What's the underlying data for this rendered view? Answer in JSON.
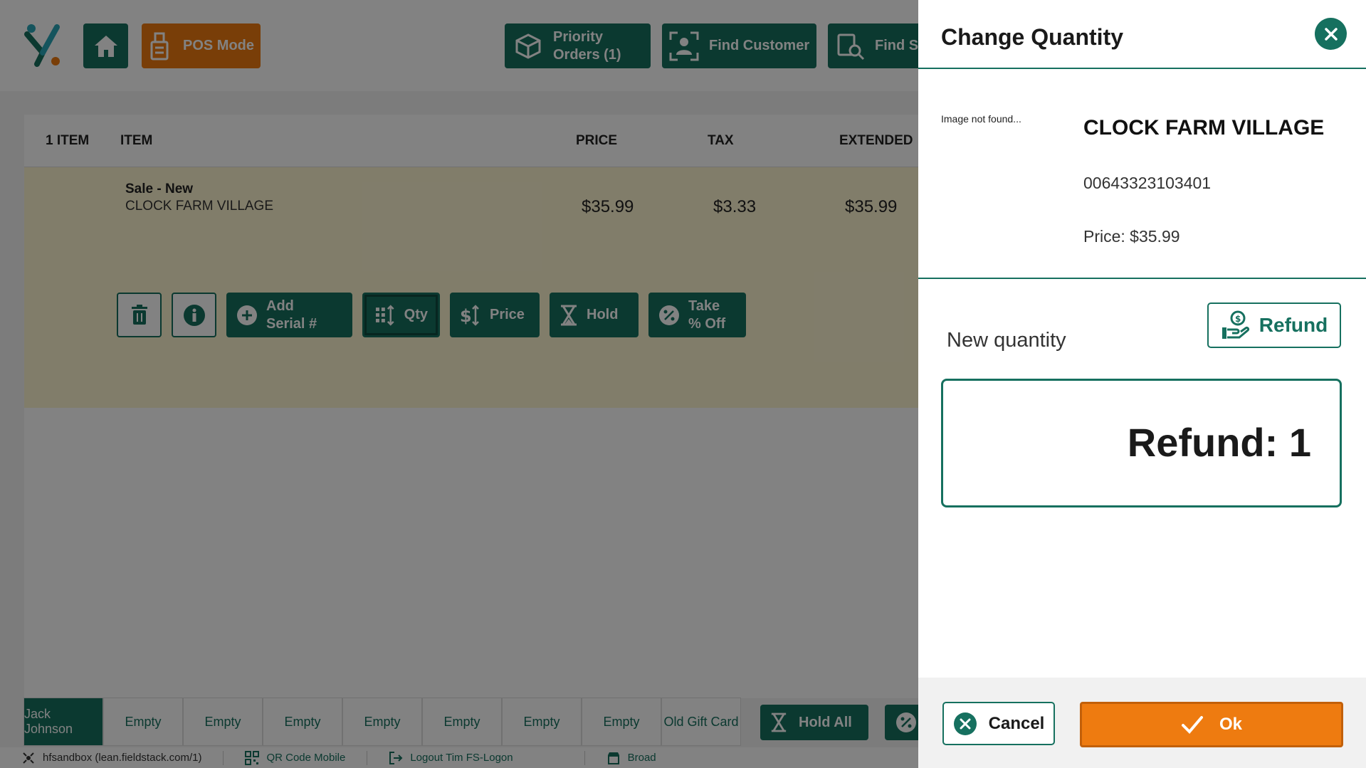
{
  "colors": {
    "teal": "#16705f",
    "orange": "#ee7b10",
    "selected_row": "#fdf5d1"
  },
  "topbar": {
    "pos_mode": "POS Mode",
    "priority_line1": "Priority",
    "priority_line2": "Orders (1)",
    "find_customer": "Find Customer",
    "find_s": "Find S"
  },
  "table": {
    "headers": {
      "count": "1 ITEM",
      "item": "ITEM",
      "price": "PRICE",
      "tax": "TAX",
      "extended": "EXTENDED"
    },
    "row": {
      "type": "Sale - New",
      "name": "CLOCK FARM VILLAGE",
      "price": "$35.99",
      "tax": "$3.33",
      "extended": "$35.99"
    },
    "actions": {
      "add_serial_1": "Add",
      "add_serial_2": "Serial #",
      "qty": "Qty",
      "price": "Price",
      "hold": "Hold",
      "take_1": "Take",
      "take_2": "% Off"
    }
  },
  "tabs": [
    "Jack Johnson",
    "Empty",
    "Empty",
    "Empty",
    "Empty",
    "Empty",
    "Empty",
    "Empty",
    "Old Gift Card"
  ],
  "hold_all": "Hold All",
  "statusbar": {
    "site": "hfsandbox (lean.fieldstack.com/1)",
    "qr": "QR Code Mobile",
    "logout": "Logout Tim FS-Logon",
    "store": "Broad"
  },
  "modal": {
    "title": "Change Quantity",
    "image_missing": "Image not found...",
    "product_name": "CLOCK FARM VILLAGE",
    "product_code": "00643323103401",
    "product_price": "Price: $35.99",
    "new_quantity_label": "New quantity",
    "refund_button": "Refund",
    "quantity_value": "Refund: 1",
    "cancel": "Cancel",
    "ok": "Ok"
  }
}
